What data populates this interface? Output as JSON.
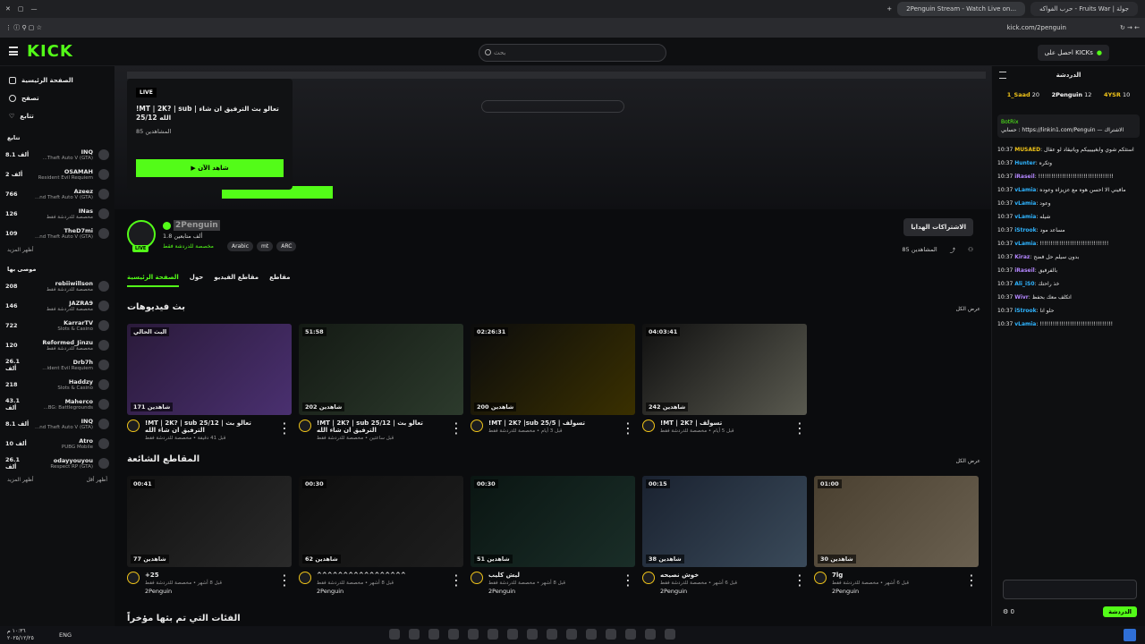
{
  "browser": {
    "tabs": [
      {
        "label": "حرب الفواكه - Fruits War | جولة"
      },
      {
        "label": "2Penguin Stream - Watch Live on..."
      }
    ],
    "address": "kick.com/2penguin"
  },
  "topbar": {
    "logo": "KICK",
    "search_placeholder": "بحث",
    "get_kicks_label": "احصل على KICKs"
  },
  "sidebar": {
    "nav": [
      {
        "label": "الصفحة الرئيسية",
        "icon": "home-icon"
      },
      {
        "label": "تصفح",
        "icon": "compass-icon"
      },
      {
        "label": "تتابع",
        "icon": "heart-icon"
      }
    ],
    "following_title": "تتابع",
    "following": [
      {
        "name": "INQ",
        "game": "...Theft Auto V (GTA)",
        "count": "8.1 ألف"
      },
      {
        "name": "OSAMAH",
        "game": "Resident Evil Requiem",
        "count": "2 ألف"
      },
      {
        "name": "Azeez",
        "game": "...nd Theft Auto V (GTA)",
        "count": "766"
      },
      {
        "name": "INas",
        "game": "مخصصة للدردشة فقط",
        "count": "126"
      },
      {
        "name": "TheD7mi",
        "game": "...nd Theft Auto V (GTA)",
        "count": "109"
      }
    ],
    "show_more": "أظهر المزيد",
    "recommended_title": "موصى بها",
    "recommended": [
      {
        "name": "rebiiwillson",
        "game": "مخصصة للدردشة فقط",
        "count": "208"
      },
      {
        "name": "JAZRA9",
        "game": "مخصصة للدردشة فقط",
        "count": "146"
      },
      {
        "name": "KarrarTV",
        "game": "Slots & Casino",
        "count": "722"
      },
      {
        "name": "Reformed_Jinzu",
        "game": "مخصصة للدردشة فقط",
        "count": "120"
      },
      {
        "name": "Drb7h",
        "game": "...ident Evil Requiem",
        "count": "26.1 ألف"
      },
      {
        "name": "Haddzy",
        "game": "Slots & Casino",
        "count": "218"
      },
      {
        "name": "Maherco",
        "game": "...BG: Battlegrounds",
        "count": "43.1 ألف"
      },
      {
        "name": "INQ",
        "game": "...nd Theft Auto V (GTA)",
        "count": "8.1 ألف"
      },
      {
        "name": "Atro",
        "game": "PUBG Mobile",
        "count": "10 ألف"
      },
      {
        "name": "odayyouyou",
        "game": "Respect RP (GTA)",
        "count": "26.1 ألف"
      }
    ],
    "show_less": "أظهر أقل",
    "show_more_2": "أظهر المزيد"
  },
  "hero": {
    "live_badge": "LIVE",
    "title": "!MT | 2K? | sub | تعالو بث الترفيق ان شاء الله 25/12",
    "viewers": "85 المشاهدين",
    "watch_label": "▶ شاهد الآن"
  },
  "profile": {
    "name": "2Penguin",
    "followers": "1.8 ألف متابعين",
    "category": "مخصصة للدردشة فقط",
    "tags": [
      "Arabic",
      "mt",
      "ARC"
    ],
    "subs_button": "الاشتراكات الهدايا",
    "viewers": "85 المشاهدين",
    "live_small": "LIVE"
  },
  "profile_tabs": [
    "الصفحة الرئيسية",
    "حول",
    "مقاطع الفيديو",
    "مقاطع"
  ],
  "vods": {
    "title": "بث فيديوهات",
    "see_all": "عرض الكل",
    "items": [
      {
        "dur": "البث الحالي",
        "views": "171 شاهدين",
        "title": "!MT | 2K? | sub 25/12 | تعالو بث الترفيق ان شاء الله",
        "sub": "قبل 41 دقيقة • مخصصة للدردشة فقط"
      },
      {
        "dur": "51:58",
        "views": "202 شاهدين",
        "title": "!MT | 2K? | sub 25/12 | تعالو بث الترفيق ان شاء الله",
        "sub": "قبل ساعتين • مخصصة للدردشة فقط"
      },
      {
        "dur": "02:26:31",
        "views": "200 شاهدين",
        "title": "!MT | 2K? |sub 25/5 | تسولف",
        "sub": "قبل 3 أيام • مخصصة للدردشة فقط"
      },
      {
        "dur": "04:03:41",
        "views": "242 شاهدين",
        "title": "!MT | 2K? | تسولف",
        "sub": "قبل 5 أيام • مخصصة للدردشة فقط"
      }
    ]
  },
  "clips": {
    "title": "المقاطع الشائعة",
    "see_all": "عرض الكل",
    "items": [
      {
        "dur": "00:41",
        "views": "77 شاهدين",
        "title": "+25",
        "sub": "قبل 8 أشهر • مخصصة للدردشة فقط",
        "chan": "2Penguin"
      },
      {
        "dur": "00:30",
        "views": "62 شاهدين",
        "title": "^^^^^^^^^^^^^^^^^",
        "sub": "قبل 8 أشهر • مخصصة للدردشة فقط",
        "chan": "2Penguin"
      },
      {
        "dur": "00:30",
        "views": "51 شاهدين",
        "title": "ليش كليب",
        "sub": "قبل 8 أشهر • مخصصة للدردشة فقط",
        "chan": "2Penguin"
      },
      {
        "dur": "00:15",
        "views": "38 شاهدين",
        "title": "خوش نصيحه",
        "sub": "قبل 6 أشهر • مخصصة للدردشة فقط",
        "chan": "2Penguin"
      },
      {
        "dur": "01:00",
        "views": "30 شاهدين",
        "title": "7lg",
        "sub": "قبل 6 أشهر • مخصصة للدردشة فقط",
        "chan": "2Penguin"
      }
    ]
  },
  "next_section": "الفئات التي تم بثها مؤخراً",
  "chat": {
    "title": "الدردشة",
    "leaders": [
      {
        "name": "1_Saad",
        "value": "20"
      },
      {
        "name": "2Penguin",
        "value": "12"
      },
      {
        "name": "4YSR",
        "value": "10"
      }
    ],
    "pinned_user": "BotRix",
    "pinned_text": "حسابي : https://linkin1.com/Penguin — الاشتراك",
    "messages": [
      {
        "time": "10:37",
        "user": "MUSAED",
        "text": "استثكم شوي وابغيييييكم وياتيقاد لو عقال",
        "color": "#f0c419"
      },
      {
        "time": "10:37",
        "user": "Hunter",
        "text": "وتكره",
        "color": "#2fb4ff"
      },
      {
        "time": "10:37",
        "user": "iRaseil",
        "text": "!!!!!!!!!!!!!!!!!!!!!!!!!!!!!!!!!!!",
        "color": "#b486ff"
      },
      {
        "time": "10:37",
        "user": "vLamia",
        "text": "مافيني الا احسن هوه مع عزيزاه وعوده",
        "color": "#2fb4ff"
      },
      {
        "time": "10:37",
        "user": "vLamia",
        "text": "وعود",
        "color": "#2fb4ff"
      },
      {
        "time": "10:37",
        "user": "vLamia",
        "text": "شيله",
        "color": "#2fb4ff"
      },
      {
        "time": "10:37",
        "user": "iStrook",
        "text": "مساعد مود",
        "color": "#2fb4ff"
      },
      {
        "time": "10:37",
        "user": "vLamia",
        "text": "!!!!!!!!!!!!!!!!!!!!!!!!!!!!!!!!",
        "color": "#2fb4ff"
      },
      {
        "time": "10:37",
        "user": "Kiraz",
        "text": "بدون سيلم حل فضح",
        "color": "#b486ff"
      },
      {
        "time": "10:37",
        "user": "iRaseil",
        "text": "بالفرفيق",
        "color": "#b486ff"
      },
      {
        "time": "10:37",
        "user": "Ali_iS0",
        "text": "خذ راحتك",
        "color": "#2fb4ff"
      },
      {
        "time": "10:37",
        "user": "Wivr",
        "text": "اتكلف معك بحفظ",
        "color": "#b486ff"
      },
      {
        "time": "10:37",
        "user": "iStrook",
        "text": "حلو انا",
        "color": "#2fb4ff"
      },
      {
        "time": "10:37",
        "user": "vLamia",
        "text": "!!!!!!!!!!!!!!!!!!!!!!!!!!!!!!!!!!",
        "color": "#2fb4ff"
      }
    ],
    "send_label": "الدردشة",
    "points": "0"
  },
  "taskbar": {
    "time": "١٠:٣٦ م",
    "date": "٢٠٢٥/١٢/٢٥",
    "lang": "ENG"
  },
  "colors": {
    "accent": "#53fc18",
    "bg": "#0b0c0e",
    "panel": "#0e0f11"
  }
}
